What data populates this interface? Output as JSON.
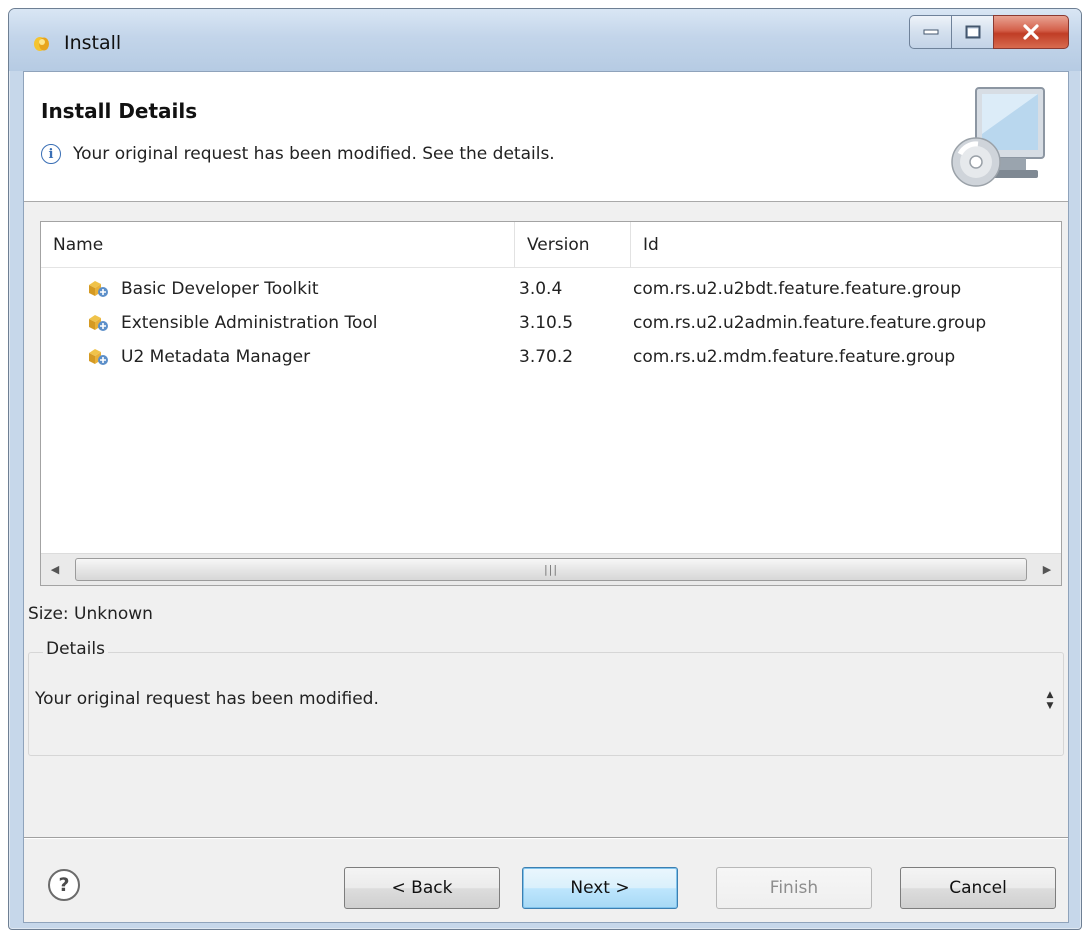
{
  "window": {
    "title": "Install"
  },
  "banner": {
    "title": "Install Details",
    "message": "Your original request has been modified.  See the details."
  },
  "table": {
    "columns": [
      "Name",
      "Version",
      "Id"
    ],
    "rows": [
      {
        "name": "Basic Developer Toolkit",
        "version": "3.0.4",
        "id": "com.rs.u2.u2bdt.feature.feature.group",
        "icon": "feature-icon"
      },
      {
        "name": "Extensible Administration Tool",
        "version": "3.10.5",
        "id": "com.rs.u2.u2admin.feature.feature.group",
        "icon": "feature-icon"
      },
      {
        "name": "U2 Metadata Manager",
        "version": "3.70.2",
        "id": "com.rs.u2.mdm.feature.feature.group",
        "icon": "feature-icon"
      }
    ]
  },
  "size_label": "Size: Unknown",
  "details": {
    "legend": "Details",
    "text": "Your original request has been modified."
  },
  "buttons": {
    "back": "< Back",
    "next": "Next >",
    "finish": "Finish",
    "cancel": "Cancel"
  },
  "colors": {
    "titlebar": "#c6d7ea",
    "close_button": "#c03d26",
    "info_accent": "#3a6fb5",
    "default_button_border": "#3c7fb1"
  }
}
